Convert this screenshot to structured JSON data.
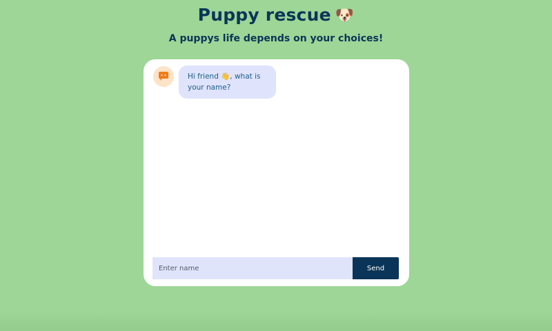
{
  "header": {
    "title": "Puppy rescue",
    "title_emoji": "🐶",
    "subtitle": "A puppys life depends on your choices!"
  },
  "chat": {
    "avatar_icon": "chat-bubble-icon",
    "messages": [
      {
        "sender": "bot",
        "text": "Hi friend 👋, what is your name?"
      }
    ],
    "input": {
      "placeholder": "Enter name",
      "value": ""
    },
    "send_label": "Send"
  },
  "colors": {
    "background": "#9dd696",
    "primary": "#0b3558",
    "bubble": "#dfe3fb",
    "bubble_text": "#1b5e8a",
    "avatar_bg": "#fde3c8",
    "avatar_icon": "#f07c1a"
  }
}
